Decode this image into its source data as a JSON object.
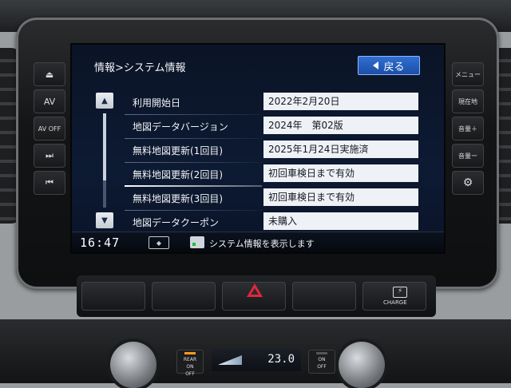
{
  "screen": {
    "breadcrumb": "情報>システム情報",
    "back_label": "戻る",
    "rows": [
      {
        "label": "利用開始日",
        "value": "2022年2月20日"
      },
      {
        "label": "地図データバージョン",
        "value": "2024年　第02版"
      },
      {
        "label": "無料地図更新(1回目)",
        "value": "2025年1月24日実施済"
      },
      {
        "label": "無料地図更新(2回目)",
        "value": "初回車検日まで有効"
      },
      {
        "label": "無料地図更新(3回目)",
        "value": "初回車検日まで有効"
      },
      {
        "label": "地図データクーポン",
        "value": "未購入"
      }
    ],
    "scroll_position": 0.0
  },
  "status_bar": {
    "clock": "16:47",
    "message": "システム情報を表示します"
  },
  "side_buttons_left": [
    "⏏",
    "AV",
    "AV OFF",
    "⏭",
    "⏮"
  ],
  "side_buttons_right": [
    "メニュー",
    "現在地",
    "音量＋",
    "音量ー",
    "⚙"
  ],
  "lower_panel": {
    "charge_label": "CHARGE"
  },
  "climate": {
    "rear_label": "REAR\nON\nOFF",
    "onoff_label": "ON\nOFF",
    "temperature": "23.0"
  },
  "icons": {
    "back": "back-triangle-icon",
    "scroll_up": "double-chevron-up-icon",
    "scroll_down": "double-chevron-down-icon",
    "ev": "ev-car-icon",
    "message": "message-icon",
    "hazard": "hazard-icon",
    "settings": "gear-icon"
  },
  "colors": {
    "accent_blue": "#2f6fd1",
    "screen_bg": "#0d1a33",
    "value_bg": "#eef1f5",
    "hazard_red": "#e2263a"
  }
}
